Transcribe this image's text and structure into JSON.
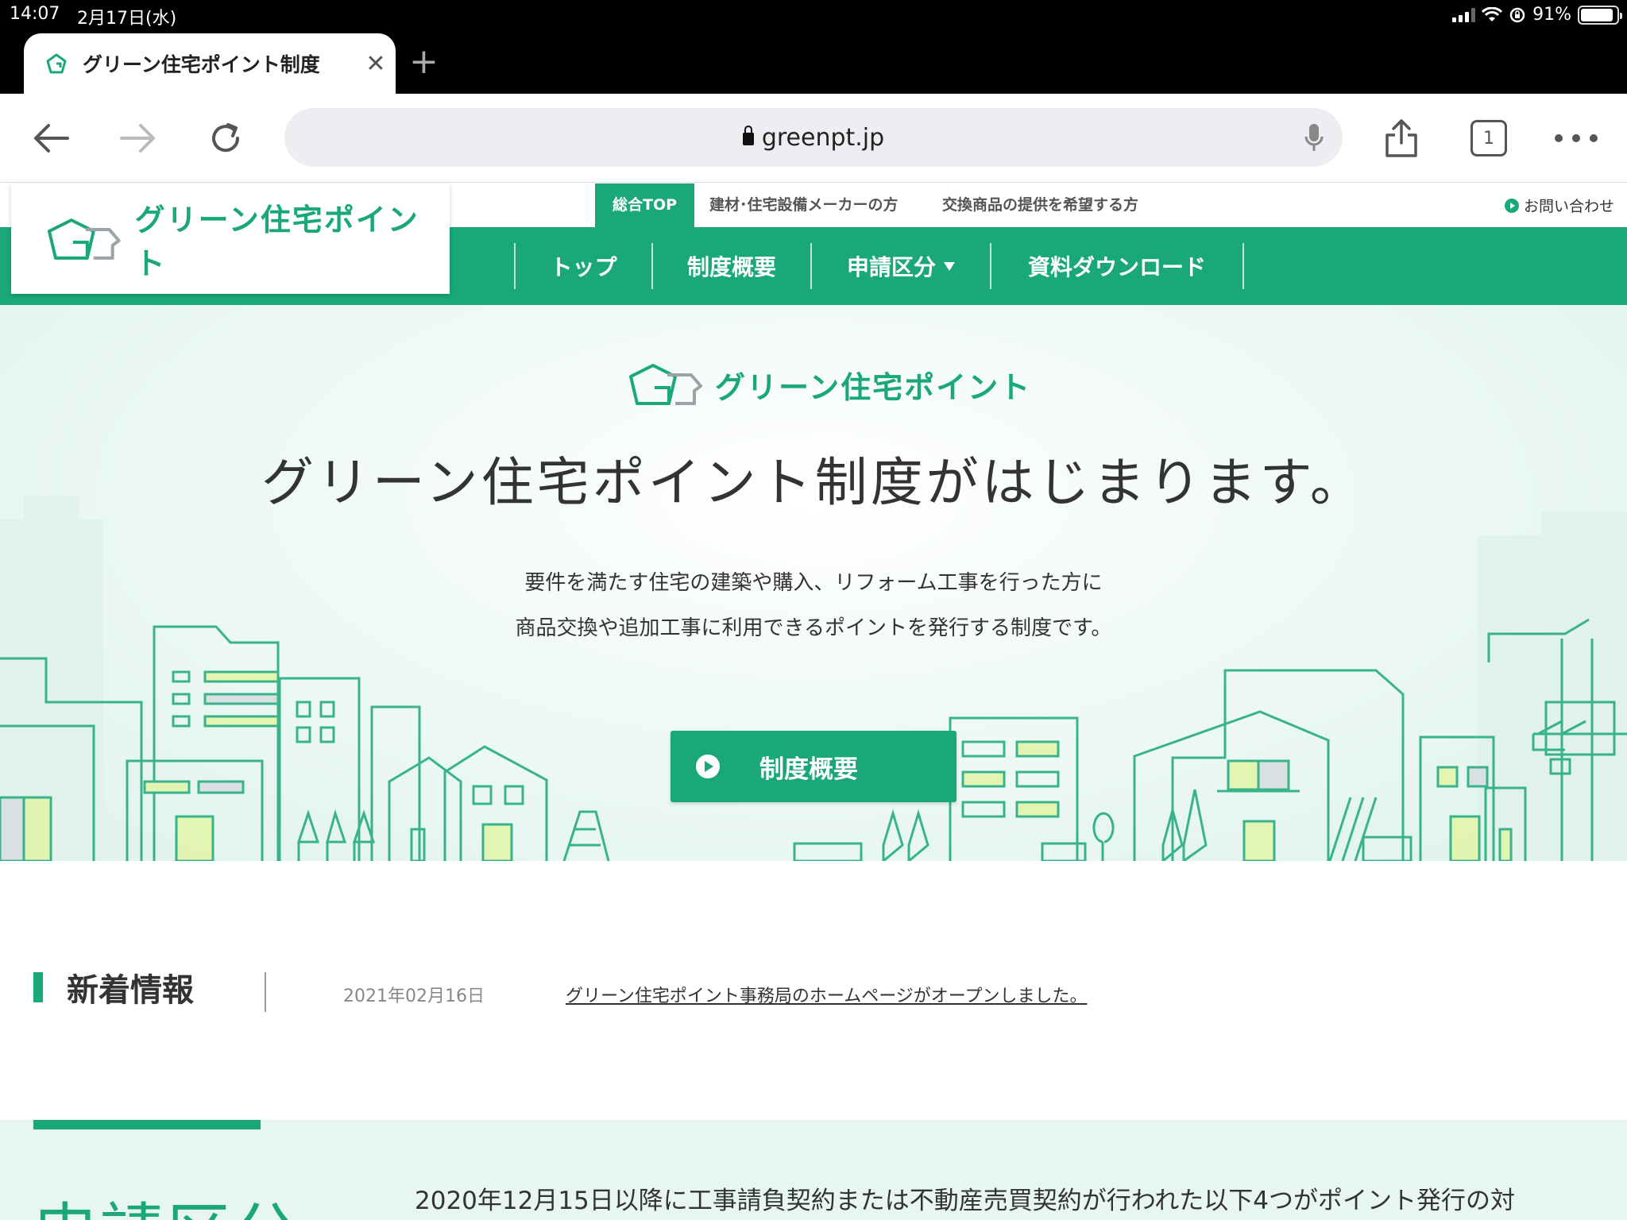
{
  "status_bar": {
    "time": "14:07",
    "date": "2月17日(水)",
    "battery": "91%",
    "battery_level": 0.91
  },
  "browser": {
    "tab_title": "グリーン住宅ポイント制度",
    "url": "greenpt.jp",
    "tab_count": "1"
  },
  "site": {
    "logo_text": "グリーン住宅ポイント",
    "subnav": [
      "総合TOP",
      "建材･住宅設備メーカーの方",
      "交換商品の提供を希望する方"
    ],
    "contact": "お問い合わせ",
    "mainnav": [
      "トップ",
      "制度概要",
      "申請区分",
      "資料ダウンロード"
    ]
  },
  "hero": {
    "logo_text": "グリーン住宅ポイント",
    "title": "グリーン住宅ポイント制度がはじまります。",
    "desc_line1": "要件を満たす住宅の建築や購入、リフォーム工事を行った方に",
    "desc_line2": "商品交換や追加工事に利用できるポイントを発行する制度です。",
    "button": "制度概要"
  },
  "news": {
    "heading": "新着情報",
    "items": [
      {
        "date": "2021年02月16日",
        "text": "グリーン住宅ポイント事務局のホームページがオープンしました。"
      }
    ]
  },
  "apply": {
    "heading": "申請区分",
    "text": "2020年12月15日以降に工事請負契約または不動産売買契約が行われた以下4つがポイント発行の対"
  },
  "colors": {
    "brand_green": "#1aa87a",
    "light_green": "#e7f6f0",
    "accent_yellow": "#e3f5a8"
  }
}
